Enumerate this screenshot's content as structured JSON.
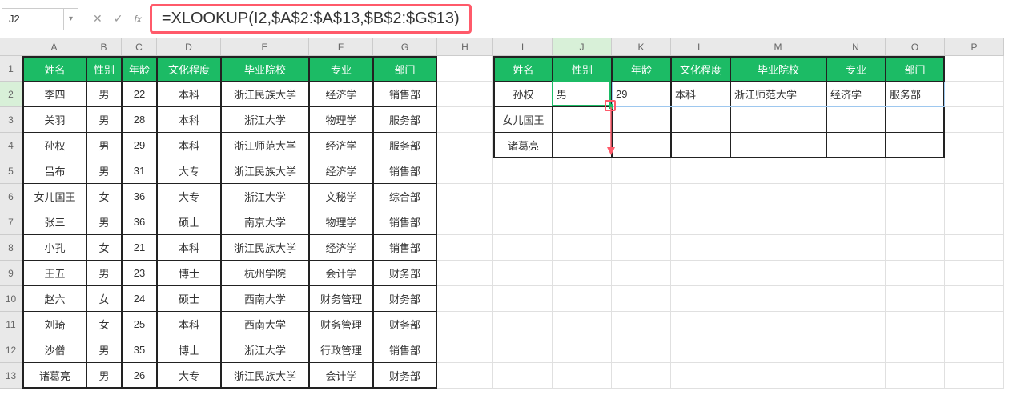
{
  "name_box": "J2",
  "formula": "=XLOOKUP(I2,$A$2:$A$13,$B$2:$G$13)",
  "fx_label": "fx",
  "columns": [
    "A",
    "B",
    "C",
    "D",
    "E",
    "F",
    "G",
    "H",
    "I",
    "J",
    "K",
    "L",
    "M",
    "N",
    "O",
    "P"
  ],
  "rows": [
    1,
    2,
    3,
    4,
    5,
    6,
    7,
    8,
    9,
    10,
    11,
    12,
    13
  ],
  "table1": {
    "headers": [
      "姓名",
      "性别",
      "年龄",
      "文化程度",
      "毕业院校",
      "专业",
      "部门"
    ],
    "data": [
      [
        "李四",
        "男",
        "22",
        "本科",
        "浙江民族大学",
        "经济学",
        "销售部"
      ],
      [
        "关羽",
        "男",
        "28",
        "本科",
        "浙江大学",
        "物理学",
        "服务部"
      ],
      [
        "孙权",
        "男",
        "29",
        "本科",
        "浙江师范大学",
        "经济学",
        "服务部"
      ],
      [
        "吕布",
        "男",
        "31",
        "大专",
        "浙江民族大学",
        "经济学",
        "销售部"
      ],
      [
        "女儿国王",
        "女",
        "36",
        "大专",
        "浙江大学",
        "文秘学",
        "综合部"
      ],
      [
        "张三",
        "男",
        "36",
        "硕士",
        "南京大学",
        "物理学",
        "销售部"
      ],
      [
        "小孔",
        "女",
        "21",
        "本科",
        "浙江民族大学",
        "经济学",
        "销售部"
      ],
      [
        "王五",
        "男",
        "23",
        "博士",
        "杭州学院",
        "会计学",
        "财务部"
      ],
      [
        "赵六",
        "女",
        "24",
        "硕士",
        "西南大学",
        "财务管理",
        "财务部"
      ],
      [
        "刘琦",
        "女",
        "25",
        "本科",
        "西南大学",
        "财务管理",
        "财务部"
      ],
      [
        "沙僧",
        "男",
        "35",
        "博士",
        "浙江大学",
        "行政管理",
        "销售部"
      ],
      [
        "诸葛亮",
        "男",
        "26",
        "大专",
        "浙江民族大学",
        "会计学",
        "财务部"
      ]
    ]
  },
  "table2": {
    "headers": [
      "姓名",
      "性别",
      "年龄",
      "文化程度",
      "毕业院校",
      "专业",
      "部门"
    ],
    "data": [
      [
        "孙权",
        "男",
        "29",
        "本科",
        "浙江师范大学",
        "经济学",
        "服务部"
      ],
      [
        "女儿国王",
        "",
        "",
        "",
        "",
        "",
        ""
      ],
      [
        "诸葛亮",
        "",
        "",
        "",
        "",
        "",
        ""
      ]
    ]
  },
  "icons": {
    "cancel": "✕",
    "confirm": "✓",
    "dropdown": "▾"
  }
}
